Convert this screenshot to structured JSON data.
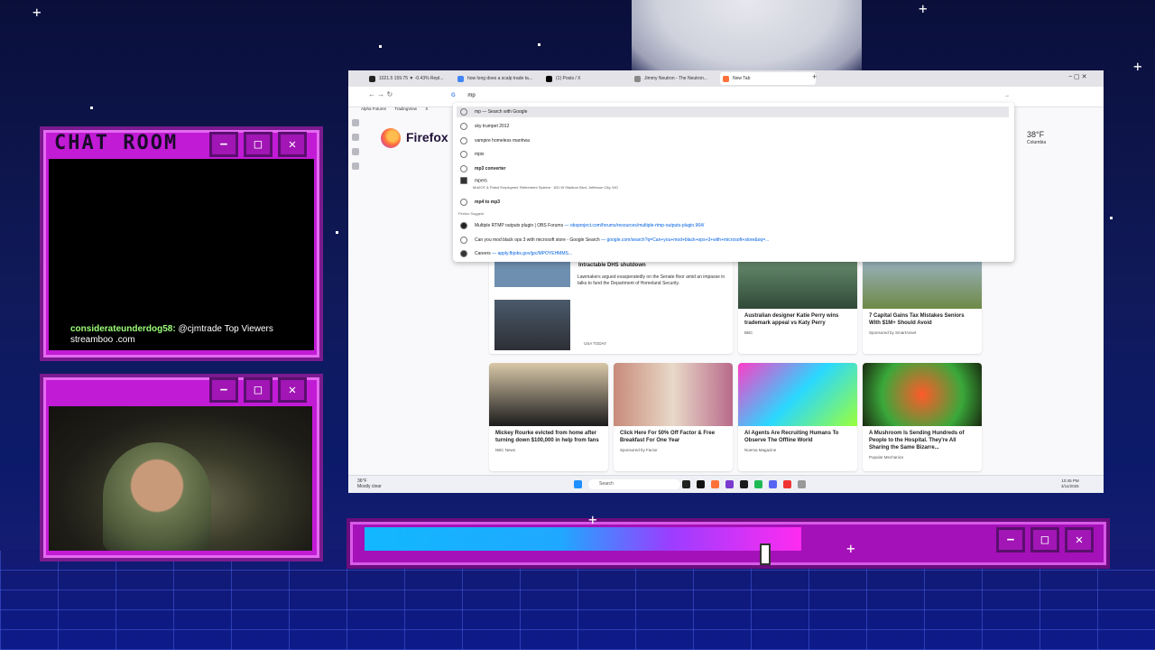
{
  "chat": {
    "title": "CHAT ROOM",
    "messages": [
      {
        "user": "considerateunderdog58:",
        "text": "@cjmtrade Top Viewers streamboo .com"
      }
    ],
    "buttons": {
      "minimize": "−",
      "maximize": "□",
      "close": "✕"
    }
  },
  "webcam": {
    "buttons": {
      "minimize": "−",
      "maximize": "□",
      "close": "✕"
    }
  },
  "browser": {
    "tabs": [
      {
        "label": "1021.5 159.75 ▼ -0.43% Repl...",
        "color": "#222"
      },
      {
        "label": "how long does a scalp trade ta...",
        "color": "#4285f4"
      },
      {
        "label": "(1) Posts / X",
        "color": "#000"
      },
      {
        "label": "Jimmy Neutron - The Neutron...",
        "color": "#888"
      },
      {
        "label": "New Tab",
        "color": "#ff7139"
      }
    ],
    "url": "mp",
    "bookmarks": [
      "Alpha Futures",
      "TradingView",
      "X"
    ],
    "brand": "Firefox",
    "weather": {
      "temp": "38°F",
      "place": "Columbia"
    },
    "suggestions": [
      {
        "text": "mp — Search with Google"
      },
      {
        "text": "sky trumpet 2012"
      },
      {
        "text": "vampire homeless manhwa"
      },
      {
        "text": "mpix"
      },
      {
        "text": "mp3 converter"
      },
      {
        "text": "mpers",
        "sub": "MoDOT & Patrol Employees' Retirement System · 831 W Stadium Blvd, Jefferson City, MO"
      },
      {
        "text": "mp4 to mp3"
      }
    ],
    "section_label": "Firefox Suggest",
    "history": [
      {
        "text": "Multiple RTMP outputs plugin | OBS Forums",
        "url": "— obsproject.com/forums/resources/multiple-rtmp-outputs-plugin.964/"
      },
      {
        "text": "Can you mod black ops 3 with microsoft store - Google Search",
        "url": "— google.com/search?q=Can+you+mod+black+ops+3+with+microsoft+store&oq=..."
      },
      {
        "text": "Careers",
        "url": "— apply.fbjobs.gov/jpc/MPOYEHMMS..."
      }
    ],
    "news": [
      {
        "title": "Intractable DHS shutdown",
        "desc": "Lawmakers argued exasperatedly on the Senate floor amid an impasse in talks to fund the Department of Homeland Security.",
        "source": "USA TODAY"
      },
      {
        "title": "Australian designer Katie Perry wins trademark appeal vs Katy Perry",
        "source": "BBC"
      },
      {
        "title": "7 Capital Gains Tax Mistakes Seniors With $1M+ Should Avoid",
        "source": "Sponsored by SmartAsset"
      },
      {
        "title": "Mickey Rourke evicted from home after turning down $100,000 in help from fans",
        "source": "NBC News"
      },
      {
        "title": "Click Here For 50% Off Factor & Free Breakfast For One Year",
        "source": "Sponsored by Factor"
      },
      {
        "title": "AI Agents Are Recruiting Humans To Observe The Offline World",
        "source": "Noema Magazine"
      },
      {
        "title": "A Mushroom Is Sending Hundreds of People to the Hospital. They're All Sharing the Same Bizarre...",
        "source": "Popular Mechanics"
      }
    ],
    "taskbar": {
      "search": "Search",
      "weather_temp": "36°F",
      "weather_text": "Mostly clear",
      "time": "10:45 PM",
      "date": "3/11/2026"
    }
  },
  "bottom_bar": {
    "progress": 0.92,
    "buttons": {
      "minimize": "−",
      "maximize": "□",
      "close": "✕"
    }
  },
  "colors": {
    "panel": "#c21bd6",
    "panel_dark": "#7a1a8f",
    "progress_start": "#12b8ff",
    "progress_end": "#ff2bf0"
  }
}
